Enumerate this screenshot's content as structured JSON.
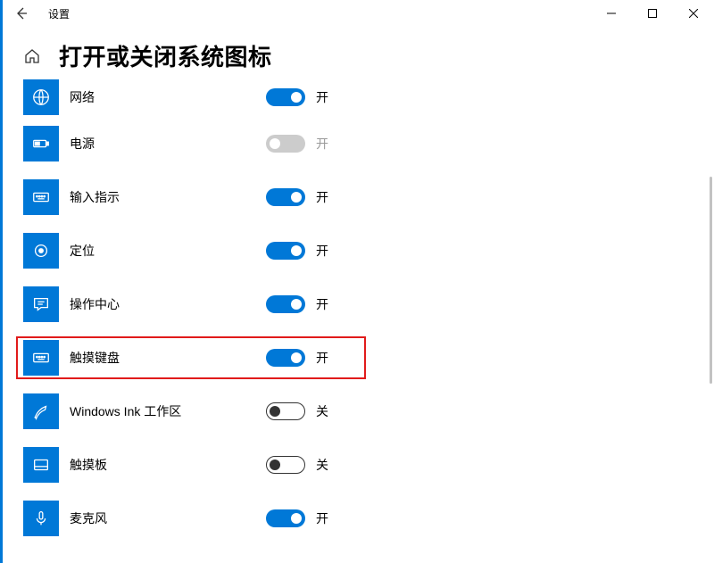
{
  "window": {
    "title": "设置"
  },
  "page": {
    "title": "打开或关闭系统图标"
  },
  "state_labels": {
    "on": "开",
    "off": "关"
  },
  "items": [
    {
      "id": "network",
      "label": "网络",
      "state": "on",
      "icon": "globe",
      "highlight": false
    },
    {
      "id": "power",
      "label": "电源",
      "state": "disabled",
      "icon": "battery",
      "highlight": false
    },
    {
      "id": "ime",
      "label": "输入指示",
      "state": "on",
      "icon": "keyboard",
      "highlight": false
    },
    {
      "id": "location",
      "label": "定位",
      "state": "on",
      "icon": "target",
      "highlight": false
    },
    {
      "id": "actioncenter",
      "label": "操作中心",
      "state": "on",
      "icon": "chat",
      "highlight": false
    },
    {
      "id": "touchkeyboard",
      "label": "触摸键盘",
      "state": "on",
      "icon": "keyboard",
      "highlight": true
    },
    {
      "id": "ink",
      "label": "Windows Ink 工作区",
      "state": "off",
      "icon": "pen",
      "highlight": false
    },
    {
      "id": "touchpad",
      "label": "触摸板",
      "state": "off",
      "icon": "touchpad",
      "highlight": false
    },
    {
      "id": "mic",
      "label": "麦克风",
      "state": "on",
      "icon": "mic",
      "highlight": false
    }
  ]
}
